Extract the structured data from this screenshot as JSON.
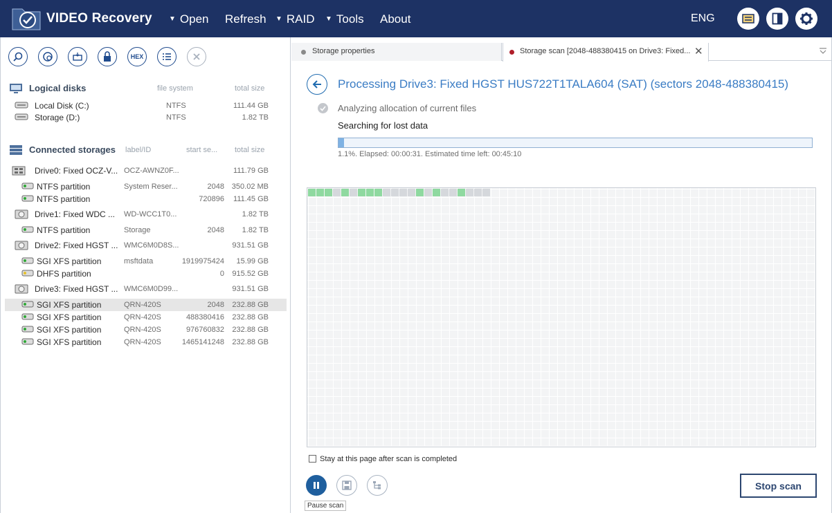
{
  "app": {
    "title": "VIDEO Recovery",
    "language": "ENG"
  },
  "menu": [
    {
      "label": "Open",
      "has_dropdown": true
    },
    {
      "label": "Refresh",
      "has_dropdown": false
    },
    {
      "label": "RAID",
      "has_dropdown": true
    },
    {
      "label": "Tools",
      "has_dropdown": true
    },
    {
      "label": "About",
      "has_dropdown": false
    }
  ],
  "toolbar_right": [
    "messages-icon",
    "panel-toggle-icon",
    "settings-icon"
  ],
  "left_toolbar": [
    "search-icon",
    "scan-icon",
    "image-icon",
    "lock-icon",
    "hex-icon",
    "list-icon",
    "close-icon"
  ],
  "left_toolbar_hex": "HEX",
  "logical_disks": {
    "heading": "Logical disks",
    "col_fs": "file system",
    "col_size": "total size",
    "items": [
      {
        "name": "Local Disk (C:)",
        "fs": "NTFS",
        "size": "111.44 GB"
      },
      {
        "name": "Storage (D:)",
        "fs": "NTFS",
        "size": "1.82 TB"
      }
    ]
  },
  "connected": {
    "heading": "Connected storages",
    "col_label": "label/ID",
    "col_start": "start se...",
    "col_size": "total size",
    "drives": [
      {
        "name": "Drive0: Fixed OCZ-V...",
        "label": "OCZ-AWNZ0F...",
        "size": "111.79 GB",
        "parts": [
          {
            "name": "NTFS partition",
            "label": "System Reser...",
            "start": "2048",
            "size": "350.02 MB"
          },
          {
            "name": "NTFS partition",
            "label": "",
            "start": "720896",
            "size": "111.45 GB"
          }
        ]
      },
      {
        "name": "Drive1: Fixed WDC ...",
        "label": "WD-WCC1T0...",
        "size": "1.82 TB",
        "parts": [
          {
            "name": "NTFS partition",
            "label": "Storage",
            "start": "2048",
            "size": "1.82 TB"
          }
        ]
      },
      {
        "name": "Drive2: Fixed HGST ...",
        "label": "WMC6M0D8S...",
        "size": "931.51 GB",
        "parts": [
          {
            "name": "SGI XFS partition",
            "label": "msftdata",
            "start": "1919975424",
            "size": "15.99 GB"
          },
          {
            "name": "DHFS partition",
            "label": "",
            "start": "0",
            "size": "915.52 GB"
          }
        ]
      },
      {
        "name": "Drive3: Fixed HGST ...",
        "label": "WMC6M0D99...",
        "size": "931.51 GB",
        "parts": [
          {
            "name": "SGI XFS partition",
            "label": "QRN-420S",
            "start": "2048",
            "size": "232.88 GB"
          },
          {
            "name": "SGI XFS partition",
            "label": "QRN-420S",
            "start": "488380416",
            "size": "232.88 GB"
          },
          {
            "name": "SGI XFS partition",
            "label": "QRN-420S",
            "start": "976760832",
            "size": "232.88 GB"
          },
          {
            "name": "SGI XFS partition",
            "label": "QRN-420S",
            "start": "1465141248",
            "size": "232.88 GB"
          }
        ]
      }
    ]
  },
  "tabs": [
    {
      "label": "Storage properties",
      "dot_color": "#8a8a8a"
    },
    {
      "label": "Storage scan [2048-488380415 on Drive3: Fixed...",
      "dot_color": "#b01e2a"
    }
  ],
  "scan": {
    "title": "Processing Drive3: Fixed HGST HUS722T1TALA604 (SAT) (sectors 2048-488380415)",
    "step_done": "Analyzing allocation of current files",
    "step_current": "Searching for lost data",
    "progress_percent": 1.1,
    "progress_text": "1.1%. Elapsed: 00:00:31. Estimated time left: 00:45:10",
    "blocks": [
      "g",
      "g",
      "g",
      "x",
      "g",
      "x",
      "g",
      "g",
      "g",
      "x",
      "x",
      "x",
      "x",
      "g",
      "x",
      "g",
      "x",
      "x",
      "g",
      "x",
      "x",
      "x"
    ],
    "stay_label": "Stay at this page after scan is completed",
    "pause_tooltip": "Pause scan",
    "stop_label": "Stop scan"
  }
}
